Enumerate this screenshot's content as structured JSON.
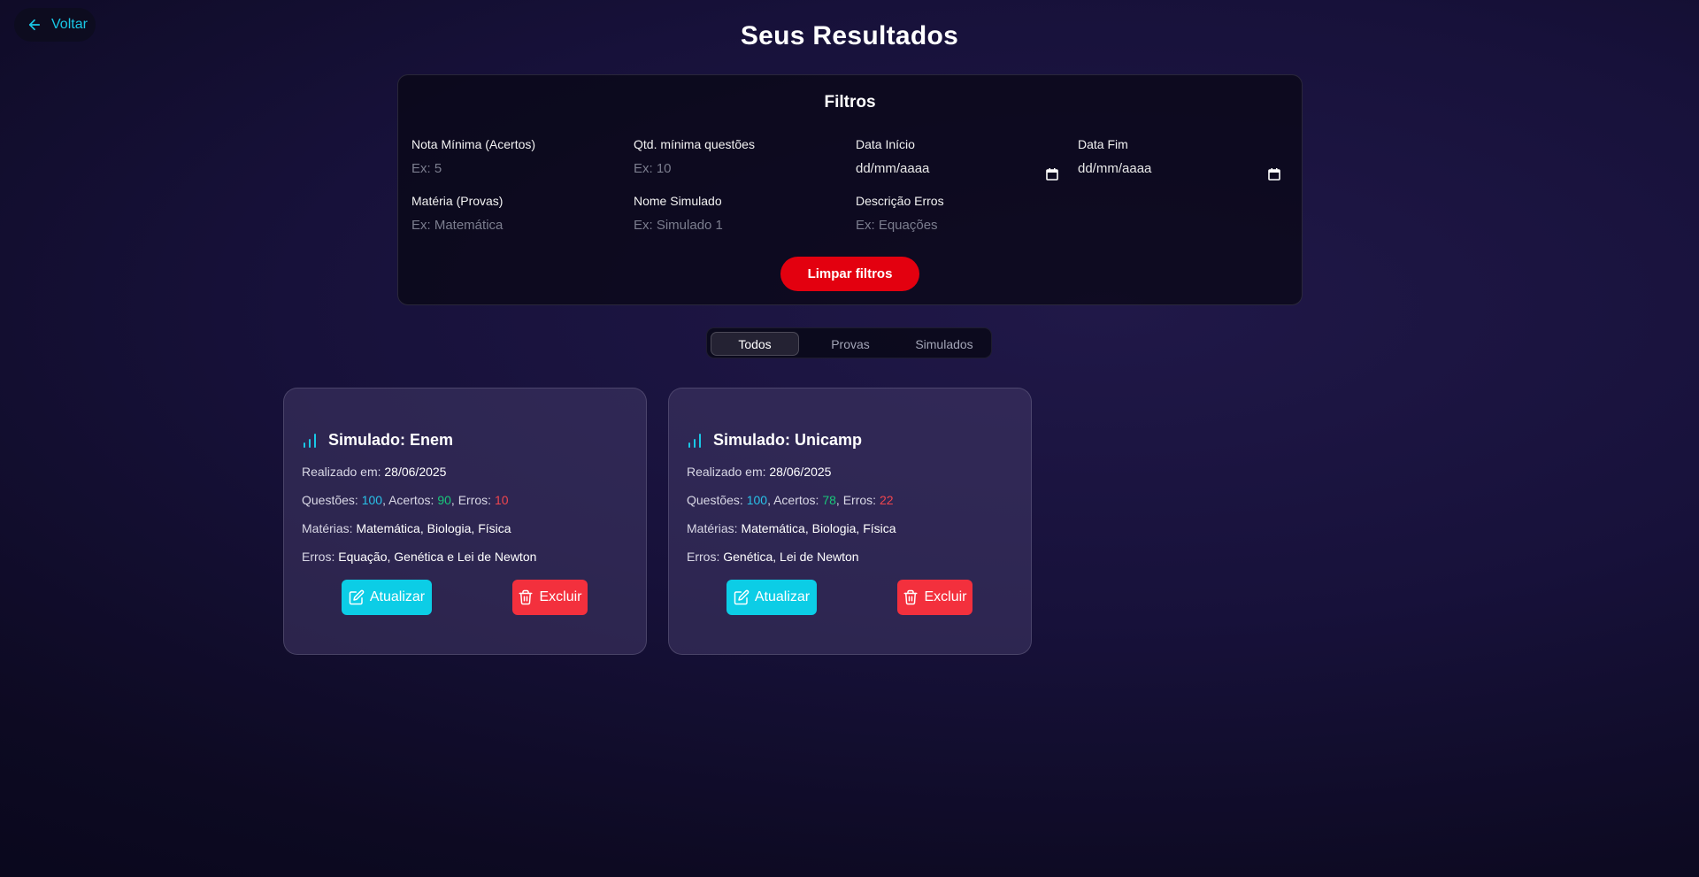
{
  "header": {
    "back_label": "Voltar",
    "title": "Seus Resultados"
  },
  "filters": {
    "title": "Filtros",
    "fields": [
      {
        "label": "Nota Mínima (Acertos)",
        "placeholder": "Ex: 5"
      },
      {
        "label": "Qtd. mínima questões",
        "placeholder": "Ex: 10"
      },
      {
        "label": "Data Início",
        "value": "dd/mm/aaaa"
      },
      {
        "label": "Data Fim",
        "value": "dd/mm/aaaa"
      },
      {
        "label": "Matéria (Provas)",
        "placeholder": "Ex: Matemática"
      },
      {
        "label": "Nome Simulado",
        "placeholder": "Ex: Simulado 1"
      },
      {
        "label": "Descrição Erros",
        "placeholder": "Ex: Equações"
      }
    ],
    "clear_label": "Limpar filtros"
  },
  "tabs": [
    {
      "label": "Todos",
      "active": true
    },
    {
      "label": "Provas",
      "active": false
    },
    {
      "label": "Simulados",
      "active": false
    }
  ],
  "cards": [
    {
      "title": "Simulado: Enem",
      "date_label": "Realizado em:",
      "date": "28/06/2025",
      "questions_label": "Questões:",
      "questions": "100",
      "hits_label": "Acertos:",
      "hits": "90",
      "errors_label": "Erros:",
      "errors": "10",
      "subjects_label": "Matérias:",
      "subjects": "Matemática, Biologia, Física",
      "mistakes_label": "Erros:",
      "mistakes": "Equação, Genética e Lei de Newton",
      "update_label": "Atualizar",
      "delete_label": "Excluir"
    },
    {
      "title": "Simulado: Unicamp",
      "date_label": "Realizado em:",
      "date": "28/06/2025",
      "questions_label": "Questões:",
      "questions": "100",
      "hits_label": "Acertos:",
      "hits": "78",
      "errors_label": "Erros:",
      "errors": "22",
      "subjects_label": "Matérias:",
      "subjects": "Matemática, Biologia, Física",
      "mistakes_label": "Erros:",
      "mistakes": "Genética, Lei de Newton",
      "update_label": "Atualizar",
      "delete_label": "Excluir"
    }
  ],
  "colors": {
    "accent": "#19c8e6",
    "clear_button": "#e3000f",
    "update_button": "#0ccde6",
    "delete_button": "#f3303d",
    "stat_blue": "#29c2e8",
    "stat_green": "#19c77a",
    "stat_red": "#f2464e"
  },
  "icons": {
    "back": "arrow-left-icon",
    "calendar": "calendar-icon",
    "chart": "bar-chart-icon",
    "edit": "edit-icon",
    "trash": "trash-icon"
  }
}
